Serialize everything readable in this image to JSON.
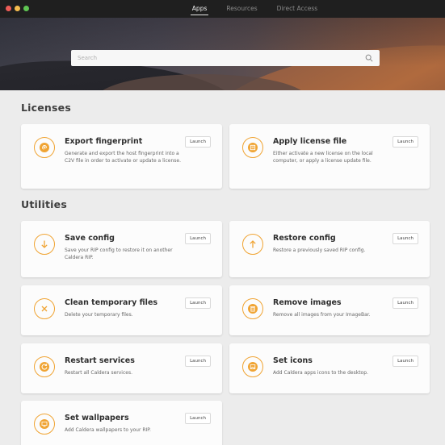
{
  "window": {
    "tabs": [
      {
        "label": "Apps",
        "active": true
      },
      {
        "label": "Resources",
        "active": false
      },
      {
        "label": "Direct Access",
        "active": false
      }
    ],
    "traffic_colors": [
      "#ed5c57",
      "#f5bd4f",
      "#5fc553"
    ]
  },
  "search": {
    "placeholder": "Search",
    "value": ""
  },
  "accent_color": "#f0a433",
  "sections": {
    "licenses": {
      "title": "Licenses"
    },
    "utilities": {
      "title": "Utilities"
    }
  },
  "cards": [
    {
      "id": "export-fingerprint",
      "icon": "fingerprint-icon",
      "title": "Export fingerprint",
      "description": "Generate and export the host fingerprint into a C2V file in order to activate or update a license.",
      "button": "Launch"
    },
    {
      "id": "apply-license-file",
      "icon": "license-file-icon",
      "title": "Apply license file",
      "description": "Either activate a new license on the local computer, or apply a license update file.",
      "button": "Launch"
    },
    {
      "id": "save-config",
      "icon": "arrow-down-icon",
      "title": "Save config",
      "description": "Save your RIP config to restore it on another Caldera RIP.",
      "button": "Launch"
    },
    {
      "id": "restore-config",
      "icon": "arrow-up-icon",
      "title": "Restore config",
      "description": "Restore a previously saved RIP config.",
      "button": "Launch"
    },
    {
      "id": "clean-temporary-files",
      "icon": "close-icon",
      "title": "Clean temporary files",
      "description": "Delete your temporary files.",
      "button": "Launch"
    },
    {
      "id": "remove-images",
      "icon": "trash-icon",
      "title": "Remove images",
      "description": "Remove all images from your ImageBar.",
      "button": "Launch"
    },
    {
      "id": "restart-services",
      "icon": "restart-icon",
      "title": "Restart services",
      "description": "Restart all Caldera services.",
      "button": "Launch"
    },
    {
      "id": "set-icons",
      "icon": "image-icon",
      "title": "Set icons",
      "description": "Add Caldera apps icons to the desktop.",
      "button": "Launch"
    },
    {
      "id": "set-wallpapers",
      "icon": "monitor-icon",
      "title": "Set wallpapers",
      "description": "Add Caldera wallpapers to your RIP.",
      "button": "Launch"
    }
  ]
}
